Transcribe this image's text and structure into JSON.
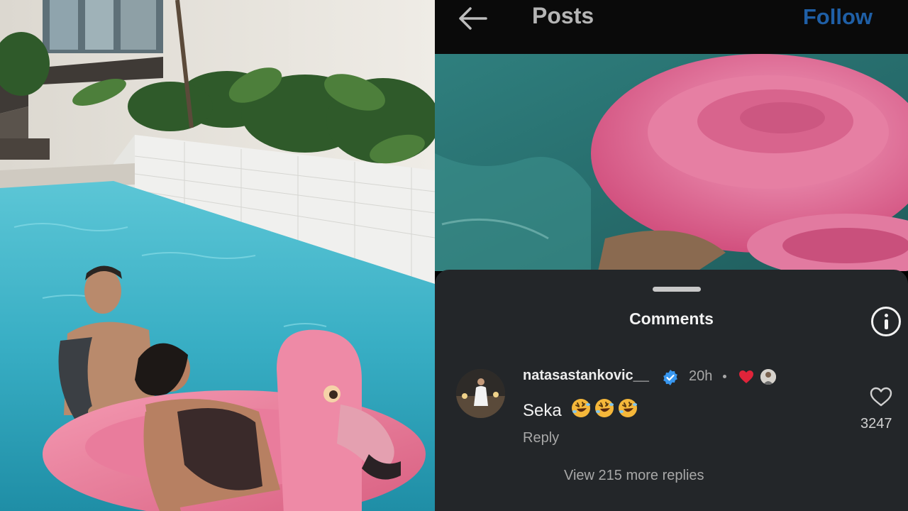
{
  "header": {
    "title": "Posts",
    "follow_label": "Follow"
  },
  "comments_sheet": {
    "title": "Comments",
    "comment": {
      "username": "natasastankovic__",
      "verified": true,
      "time": "20h",
      "text": "Seka",
      "emojis": [
        "rolling-on-floor-laughing",
        "rolling-on-floor-laughing",
        "rolling-on-floor-laughing"
      ],
      "reply_label": "Reply",
      "like_count": "3247",
      "liked_by_creator": true
    },
    "view_replies_label": "View 215 more replies"
  },
  "icons": {
    "back": "arrow-left-icon",
    "info": "info-icon",
    "verified": "verified-badge-icon",
    "heart": "heart-icon",
    "like": "heart-outline-icon"
  },
  "colors": {
    "follow": "#1f5fa6",
    "sheet_bg": "#232629",
    "verified": "#3897f0",
    "heart": "#e0243a"
  }
}
